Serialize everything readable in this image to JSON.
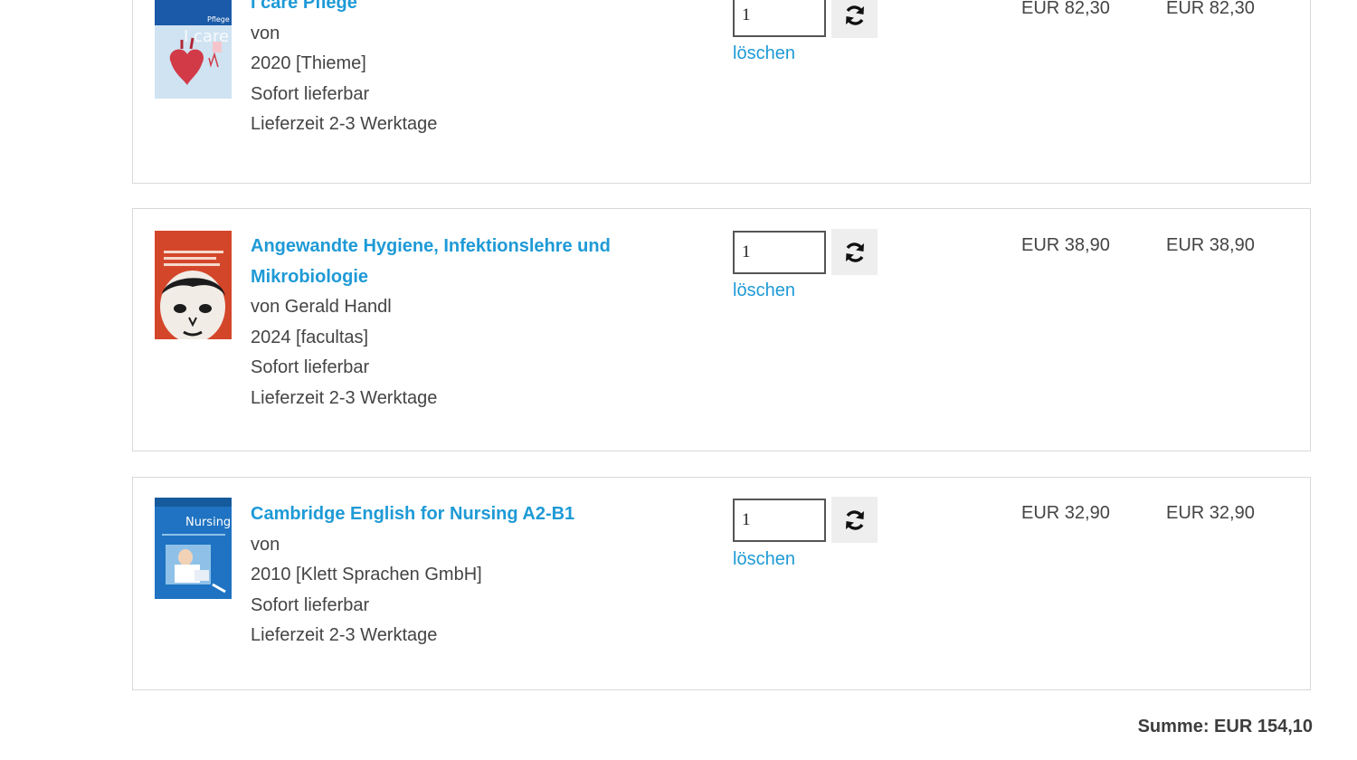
{
  "cart": {
    "items": [
      {
        "title": "I care Pflege",
        "author": "von",
        "year_publisher": "2020 [Thieme]",
        "availability": "Sofort lieferbar",
        "delivery": "Lieferzeit 2-3 Werktage",
        "quantity": "1",
        "delete_label": "löschen",
        "unit_price": "EUR 82,30",
        "total_price": "EUR 82,30",
        "cover_colors": {
          "primary": "#1a5aa8",
          "secondary": "#cfe3f2",
          "accent": "#d23a48"
        },
        "cover_text": "I care"
      },
      {
        "title_line1": "Angewandte Hygiene, Infektionslehre und",
        "title_line2": "Mikrobiologie",
        "author": "von Gerald Handl",
        "year_publisher": "2024 [facultas]",
        "availability": "Sofort lieferbar",
        "delivery": "Lieferzeit 2-3 Werktage",
        "quantity": "1",
        "delete_label": "löschen",
        "unit_price": "EUR 38,90",
        "total_price": "EUR 38,90",
        "cover_colors": {
          "primary": "#d4462a",
          "secondary": "#f1ece6",
          "accent": "#1c1c1c"
        }
      },
      {
        "title": "Cambridge English for Nursing A2-B1",
        "author": "von",
        "year_publisher": "2010 [Klett Sprachen GmbH]",
        "availability": "Sofort lieferbar",
        "delivery": "Lieferzeit 2-3 Werktage",
        "quantity": "1",
        "delete_label": "löschen",
        "unit_price": "EUR 32,90",
        "total_price": "EUR 32,90",
        "cover_colors": {
          "primary": "#1f73c2",
          "secondary": "#8fc1e8",
          "accent": "#ffffff"
        },
        "cover_text": "Nursing"
      }
    ],
    "sum_label": "Summe: EUR 154,10"
  },
  "colors": {
    "link": "#1e9ad6",
    "text": "#3d3d3d",
    "border": "#d9d9d9",
    "button_bg": "#eeeeee"
  },
  "icons": {
    "refresh": "refresh-icon"
  }
}
